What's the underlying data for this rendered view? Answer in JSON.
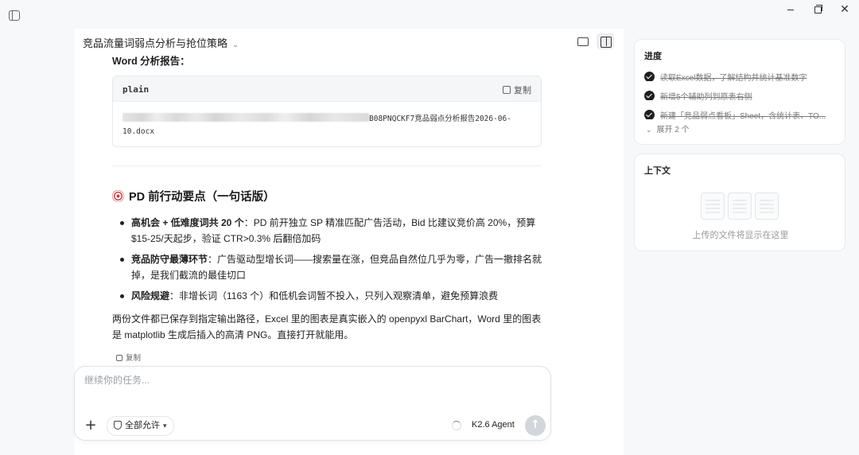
{
  "window": {
    "min_glyph": "",
    "max_glyph": "",
    "close_glyph": "✕"
  },
  "chat": {
    "title": "竞品流量词弱点分析与抢位策略",
    "report_label": "Word 分析报告：",
    "code_block": {
      "language": "plain",
      "copy_label": "复制",
      "path_line1_visible": "B08PNQCKF7竞品弱点分析报告2026-06-",
      "path_line2": "10.docx"
    },
    "section_heading": "PD 前行动要点（一句话版）",
    "bullets": [
      {
        "bold": "高机会 + 低难度词共 20 个",
        "text": "：PD 前开独立 SP 精准匹配广告活动，Bid 比建议竞价高 20%，预算 $15-25/天起步，验证 CTR>0.3% 后翻倍加码"
      },
      {
        "bold": "竞品防守最薄环节",
        "text": "：广告驱动型增长词——搜索量在涨，但竞品自然位几乎为零，广告一撤排名就掉，是我们截流的最佳切口"
      },
      {
        "bold": "风险规避",
        "text": "：非增长词（1163 个）和低机会词暂不投入，只列入观察清单，避免预算浪费"
      }
    ],
    "summary": "两份文件都已保存到指定输出路径，Excel 里的图表是真实嵌入的 openpyxl BarChart，Word 里的图表是 matplotlib 生成后插入的高清 PNG。直接打开就能用。",
    "message_copy_label": "复制"
  },
  "composer": {
    "placeholder": "继续你的任务...",
    "add_glyph": "+",
    "permission_label": "全部允许",
    "agent_label": "K2.6 Agent",
    "send_glyph": "↑"
  },
  "progress": {
    "title": "进度",
    "items": [
      {
        "label": "读取Excel数据，了解结构并统计基准数字",
        "done": true
      },
      {
        "label": "新增5个辅助列到原表右侧",
        "done": true
      },
      {
        "label": "新建「竞品弱点看板」Sheet，含统计表、TO...",
        "done": true
      }
    ],
    "expand_label": "展开 2 个"
  },
  "context": {
    "title": "上下文",
    "empty_hint": "上传的文件将显示在这里"
  }
}
